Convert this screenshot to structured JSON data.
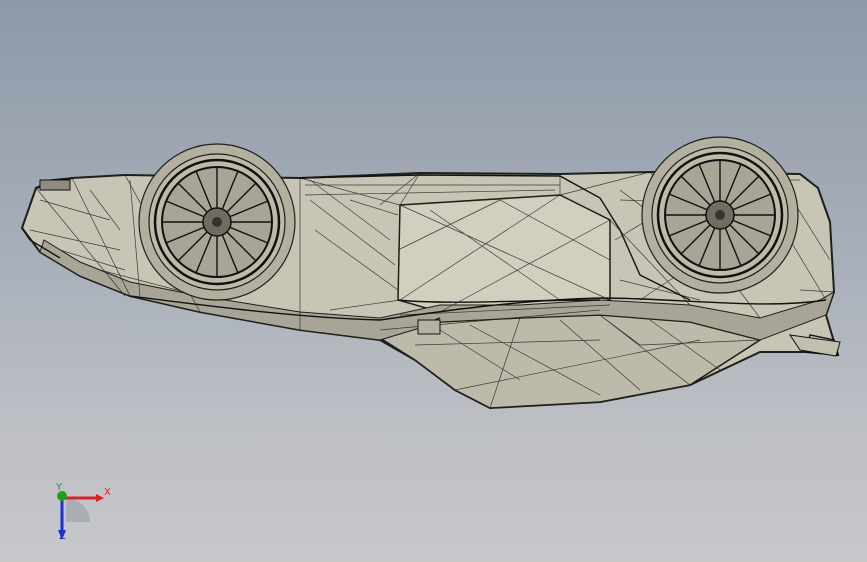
{
  "triad": {
    "x_label": "X",
    "y_label": "Y",
    "z_label": "Z"
  },
  "colors": {
    "body_fill": "#c9c6b6",
    "body_shadow": "#9d9a8b",
    "wireframe": "#1e1e1a",
    "x_axis": "#e02020",
    "y_axis": "#20a020",
    "z_axis": "#2030d0"
  },
  "icons": {
    "orientation_triad": "axis-triad-icon",
    "front_wheel": "wheel-icon",
    "rear_wheel": "wheel-icon"
  }
}
